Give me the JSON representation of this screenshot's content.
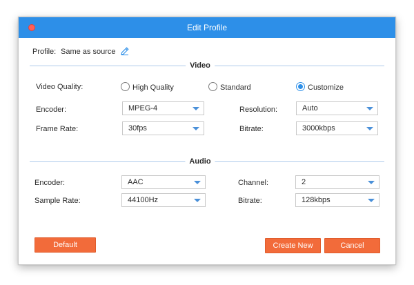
{
  "window": {
    "title": "Edit Profile"
  },
  "profile": {
    "label": "Profile:",
    "value": "Same as source",
    "edit_icon": "pencil-icon"
  },
  "video": {
    "section_title": "Video",
    "quality_label": "Video Quality:",
    "quality_options": [
      {
        "label": "High Quality",
        "selected": false
      },
      {
        "label": "Standard",
        "selected": false
      },
      {
        "label": "Customize",
        "selected": true
      }
    ],
    "encoder_label": "Encoder:",
    "encoder_value": "MPEG-4",
    "resolution_label": "Resolution:",
    "resolution_value": "Auto",
    "frame_rate_label": "Frame Rate:",
    "frame_rate_value": "30fps",
    "bitrate_label": "Bitrate:",
    "bitrate_value": "3000kbps"
  },
  "audio": {
    "section_title": "Audio",
    "encoder_label": "Encoder:",
    "encoder_value": "AAC",
    "channel_label": "Channel:",
    "channel_value": "2",
    "sample_rate_label": "Sample Rate:",
    "sample_rate_value": "44100Hz",
    "bitrate_label": "Bitrate:",
    "bitrate_value": "128kbps"
  },
  "buttons": {
    "default": "Default",
    "create_new": "Create New",
    "cancel": "Cancel"
  },
  "colors": {
    "titlebar": "#2d8fe8",
    "accent_button": "#f26b3a",
    "close_dot": "#ff5f57",
    "section_line": "#aac9ea"
  }
}
